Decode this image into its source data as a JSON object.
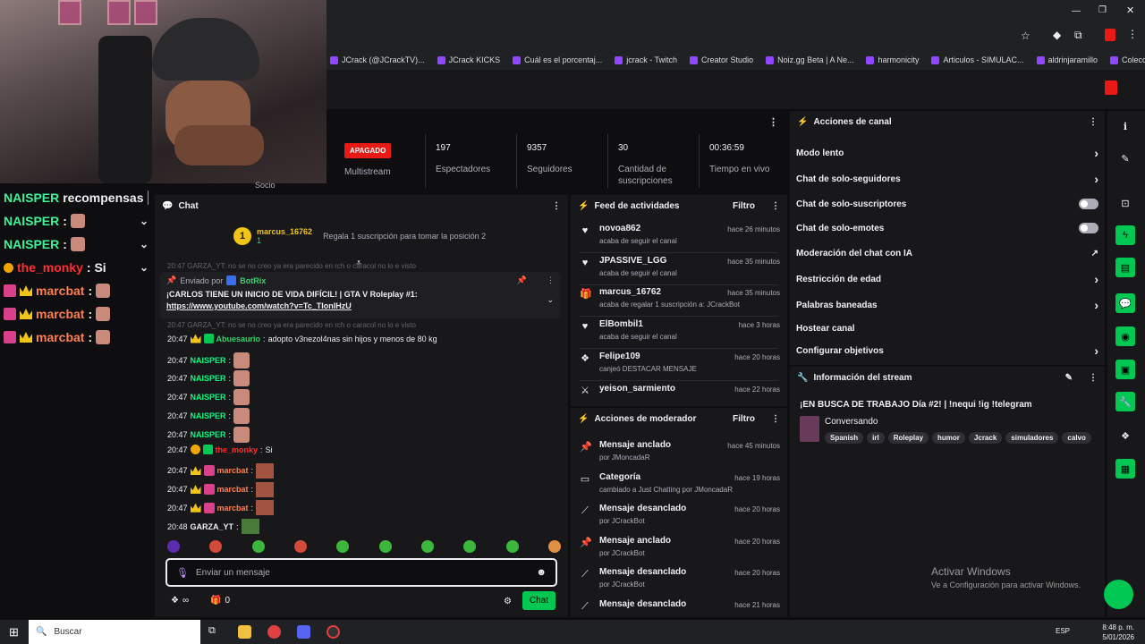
{
  "bookmarks": [
    "JCrack (@JCrackTV)...",
    "JCrack KICKS",
    "Cuál es el porcentaj...",
    "jcrack - Twitch",
    "Creator Studio",
    "Noiz.gg Beta | A Ne...",
    "harmonicity",
    "Articulos - SIMULAC...",
    "aldrinjaramillo",
    "Colección de M_blei..."
  ],
  "overlay": {
    "rows": [
      {
        "name": "NAISPER",
        "suffix": "recompensas",
        "chev": ""
      },
      {
        "name": "NAISPER",
        "suffix": ":",
        "chev": "⌄"
      },
      {
        "name": "NAISPER",
        "suffix": ":",
        "chev": "⌄"
      },
      {
        "name": "the_monky",
        "suffix": ": Si",
        "chev": "⌄"
      },
      {
        "name": "marcbat",
        "suffix": ":",
        "chev": ""
      },
      {
        "name": "marcbat",
        "suffix": ":",
        "chev": ""
      },
      {
        "name": "marcbat",
        "suffix": ":",
        "chev": ""
      }
    ]
  },
  "stats": {
    "status": "APAGADO",
    "status_label": "Multistream",
    "viewers": "197",
    "viewers_label": "Espectadores",
    "followers": "9357",
    "followers_label": "Seguidores",
    "subs": "30",
    "subs_label": "Cantidad de suscripciones",
    "uptime": "00:36:59",
    "uptime_label": "Tiempo en vivo",
    "socio": "Socio"
  },
  "chat": {
    "title": "Chat",
    "hype_user": "marcus_16762",
    "hype_rank": "1",
    "hype_count": "1",
    "hype_text": "Regala 1 suscripción para tomar la posición 2",
    "pinned_by_label": "Enviado por",
    "pinned_by": "BotRix",
    "pinned_text": "¡CARLOS TIENE UN INICIO DE VIDA DIFÍCIL! | GTA V Roleplay #1:",
    "pinned_link": "https://www.youtube.com/watch?v=Tc_TIonIHzU",
    "partial_line": "20:47 GARZA_YT: no se no creo ya era parecido en rch o caracol no lo e visto",
    "messages": [
      {
        "ts": "20:47",
        "name": "Abuesaurio",
        "text": "adopto v3nezol4nas sin hijos y menos de 80 kg",
        "style": "g"
      },
      {
        "ts": "20:47",
        "name": "NAISPER",
        "text": "",
        "style": "n"
      },
      {
        "ts": "20:47",
        "name": "NAISPER",
        "text": "",
        "style": "n"
      },
      {
        "ts": "20:47",
        "name": "NAISPER",
        "text": "",
        "style": "n"
      },
      {
        "ts": "20:47",
        "name": "NAISPER",
        "text": "",
        "style": "n"
      },
      {
        "ts": "20:47",
        "name": "NAISPER",
        "text": "",
        "style": "n"
      },
      {
        "ts": "20:47",
        "name": "the_monky",
        "text": "Si",
        "style": "r"
      },
      {
        "ts": "20:47",
        "name": "marcbat",
        "text": "",
        "style": "o"
      },
      {
        "ts": "20:47",
        "name": "marcbat",
        "text": "",
        "style": "o"
      },
      {
        "ts": "20:47",
        "name": "marcbat",
        "text": "",
        "style": "o"
      },
      {
        "ts": "20:48",
        "name": "GARZA_YT",
        "text": "",
        "style": "w"
      }
    ],
    "placeholder": "Enviar un mensaje",
    "points": "∞",
    "bits": "0",
    "send": "Chat"
  },
  "feed": {
    "title": "Feed de actividades",
    "filter": "Filtro",
    "items": [
      {
        "user": "novoa862",
        "desc": "acaba de seguir el canal",
        "time": "hace 26 minutos",
        "icon": "heart-icon"
      },
      {
        "user": "JPASSIVE_LGG",
        "desc": "acaba de seguir el canal",
        "time": "hace 35 minutos",
        "icon": "heart-icon"
      },
      {
        "user": "marcus_16762",
        "desc": "acaba de regalar 1 suscripción a: JCrackBot",
        "time": "hace 35 minutos",
        "icon": "gift-icon"
      },
      {
        "user": "ElBombil1",
        "desc": "acaba de seguir el canal",
        "time": "hace 3 horas",
        "icon": "heart-icon"
      },
      {
        "user": "Felipe109",
        "desc": "canjeó DESTACAR MENSAJE",
        "time": "hace 20 horas",
        "icon": "points-icon"
      },
      {
        "user": "yeison_sarmiento",
        "desc": "",
        "time": "hace 22 horas",
        "icon": "raid-icon"
      }
    ]
  },
  "mod": {
    "title": "Acciones de moderador",
    "filter": "Filtro",
    "items": [
      {
        "action": "Mensaje anclado",
        "by": "por JMoncadaR",
        "time": "hace 45 minutos",
        "icon": "pin-icon"
      },
      {
        "action": "Categoría",
        "by": "cambiado a Just Chatting por JMoncadaR",
        "time": "hace 19 horas",
        "icon": "category-icon"
      },
      {
        "action": "Mensaje desanclado",
        "by": "por JCrackBot",
        "time": "hace 20 horas",
        "icon": "unpin-icon"
      },
      {
        "action": "Mensaje anclado",
        "by": "por JCrackBot",
        "time": "hace 20 horas",
        "icon": "pin-icon"
      },
      {
        "action": "Mensaje desanclado",
        "by": "por JCrackBot",
        "time": "hace 20 horas",
        "icon": "unpin-icon"
      },
      {
        "action": "Mensaje desanclado",
        "by": "",
        "time": "hace 21 horas",
        "icon": "unpin-icon"
      }
    ]
  },
  "canal": {
    "title": "Acciones de canal",
    "rows": [
      {
        "label": "Modo lento",
        "ctrl": "arrow"
      },
      {
        "label": "Chat de solo-seguidores",
        "ctrl": "arrow"
      },
      {
        "label": "Chat de solo-suscriptores",
        "ctrl": "toggle"
      },
      {
        "label": "Chat de solo-emotes",
        "ctrl": "toggle"
      },
      {
        "label": "Moderación del chat con IA",
        "ctrl": "ext"
      },
      {
        "label": "Restricción de edad",
        "ctrl": "arrow"
      },
      {
        "label": "Palabras baneadas",
        "ctrl": "arrow"
      },
      {
        "label": "Hostear canal",
        "ctrl": "none"
      },
      {
        "label": "Configurar objetivos",
        "ctrl": "arrow"
      }
    ]
  },
  "info": {
    "title": "Información del stream",
    "stream_title": "¡EN BUSCA DE TRABAJO Día #2! | !nequi !ig !telegram",
    "category": "Conversando",
    "tags": [
      "Spanish",
      "irl",
      "Roleplay",
      "humor",
      "Jcrack",
      "simuladores",
      "calvo"
    ]
  },
  "watermark": {
    "l1": "Activar Windows",
    "l2": "Ve a Configuración para activar Windows."
  },
  "taskbar": {
    "search": "Buscar",
    "time": "8:48 p. m.",
    "date": "5/01/2026",
    "lang": "ESP"
  }
}
